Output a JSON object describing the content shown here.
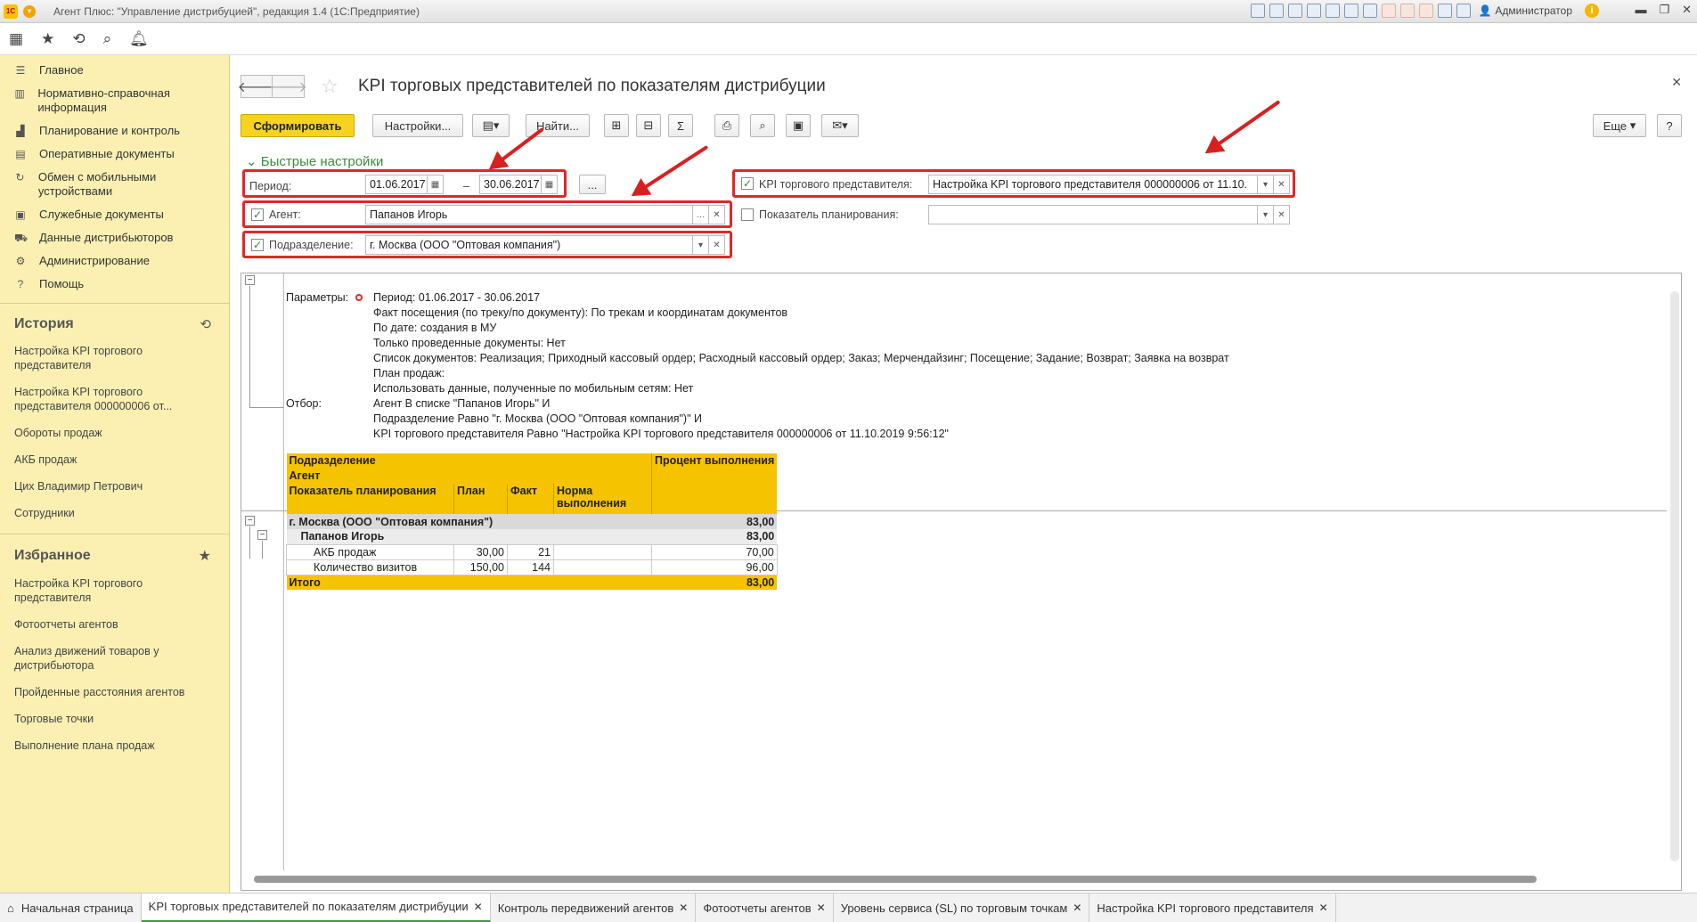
{
  "window": {
    "title": "Агент Плюс: \"Управление дистрибуцией\", редакция 1.4  (1С:Предприятие)",
    "logo": "1С",
    "user": "Администратор"
  },
  "sidebar": {
    "sections": [
      {
        "label": "Главное",
        "icon": "menu-lines-icon"
      },
      {
        "label": "Нормативно-справочная информация",
        "icon": "books-icon"
      },
      {
        "label": "Планирование и контроль",
        "icon": "bar-chart-icon"
      },
      {
        "label": "Оперативные документы",
        "icon": "document-icon"
      },
      {
        "label": "Обмен с мобильными устройствами",
        "icon": "sync-icon"
      },
      {
        "label": "Служебные документы",
        "icon": "folder-icon"
      },
      {
        "label": "Данные дистрибьюторов",
        "icon": "truck-icon"
      },
      {
        "label": "Администрирование",
        "icon": "gear-icon"
      },
      {
        "label": "Помощь",
        "icon": "question-icon"
      }
    ],
    "history": {
      "title": "История",
      "items": [
        "Настройка KPI торгового представителя",
        "Настройка KPI торгового представителя 000000006 от...",
        "Обороты продаж",
        "АКБ продаж",
        "Цих Владимир Петрович",
        "Сотрудники"
      ]
    },
    "favorites": {
      "title": "Избранное",
      "items": [
        "Настройка KPI торгового представителя",
        "Фотоотчеты агентов",
        "Анализ движений товаров у дистрибьютора",
        "Пройденные расстояния агентов",
        "Торговые точки",
        "Выполнение плана продаж"
      ]
    }
  },
  "main": {
    "title": "KPI торговых представителей по показателям дистрибуции",
    "toolbar": {
      "generate": "Сформировать",
      "settings": "Настройки...",
      "find": "Найти...",
      "sum": "Σ",
      "more": "Еще",
      "help": "?"
    },
    "quick_settings": {
      "header": "Быстрые настройки",
      "period_label": "Период:",
      "period_from": "01.06.2017",
      "period_dash": "–",
      "period_to": "30.06.2017",
      "period_more": "...",
      "agent_label": "Агент:",
      "agent_value": "Папанов Игорь",
      "dept_label": "Подразделение:",
      "dept_value": "г. Москва  (ООО \"Оптовая компания\")",
      "kpi_label": "KPI торгового представителя:",
      "kpi_value": "Настройка KPI торгового представителя 000000006 от 11.10.",
      "plan_label": "Показатель планирования:",
      "plan_value": ""
    },
    "report": {
      "params_label": "Параметры:",
      "params": [
        "Период: 01.06.2017 - 30.06.2017",
        "Факт посещения (по треку/по документу): По трекам и координатам документов",
        "По дате: создания в МУ",
        "Только проведенные документы: Нет",
        "Список документов: Реализация; Приходный кассовый ордер; Расходный кассовый ордер; Заказ; Мерчендайзинг; Посещение; Задание; Возврат; Заявка на возврат",
        "План продаж:",
        "Использовать данные, полученные по мобильным сетям: Нет"
      ],
      "filter_label": "Отбор:",
      "filters": [
        "Агент В списке \"Папанов Игорь\" И",
        "Подразделение Равно \"г. Москва  (ООО \"Оптовая компания\")\" И",
        " KPI торгового представителя Равно \"Настройка KPI торгового представителя 000000006 от 11.10.2019 9:56:12\""
      ],
      "table": {
        "h1": "Подразделение",
        "h2": "Агент",
        "h3": "Показатель планирования",
        "h_plan": "План",
        "h_fact": "Факт",
        "h_norm": "Норма выполнения",
        "h_pct": "Процент выполнения",
        "dept": {
          "name": "г. Москва  (ООО \"Оптовая компания\")",
          "pct": "83,00"
        },
        "agent": {
          "name": "Папанов Игорь",
          "pct": "83,00"
        },
        "rows": [
          {
            "name": "АКБ продаж",
            "plan": "30,00",
            "fact": "21",
            "norm": "",
            "pct": "70,00"
          },
          {
            "name": "Количество визитов",
            "plan": "150,00",
            "fact": "144",
            "norm": "",
            "pct": "96,00"
          }
        ],
        "total": {
          "name": "Итого",
          "pct": "83,00"
        }
      }
    }
  },
  "tabs": [
    {
      "label": "Начальная страница",
      "icon": "home-icon"
    },
    {
      "label": "KPI торговых представителей по показателям дистрибуции"
    },
    {
      "label": "Контроль передвижений агентов"
    },
    {
      "label": "Фотоотчеты агентов"
    },
    {
      "label": "Уровень сервиса (SL) по торговым точкам"
    },
    {
      "label": "Настройка KPI торгового представителя"
    }
  ]
}
